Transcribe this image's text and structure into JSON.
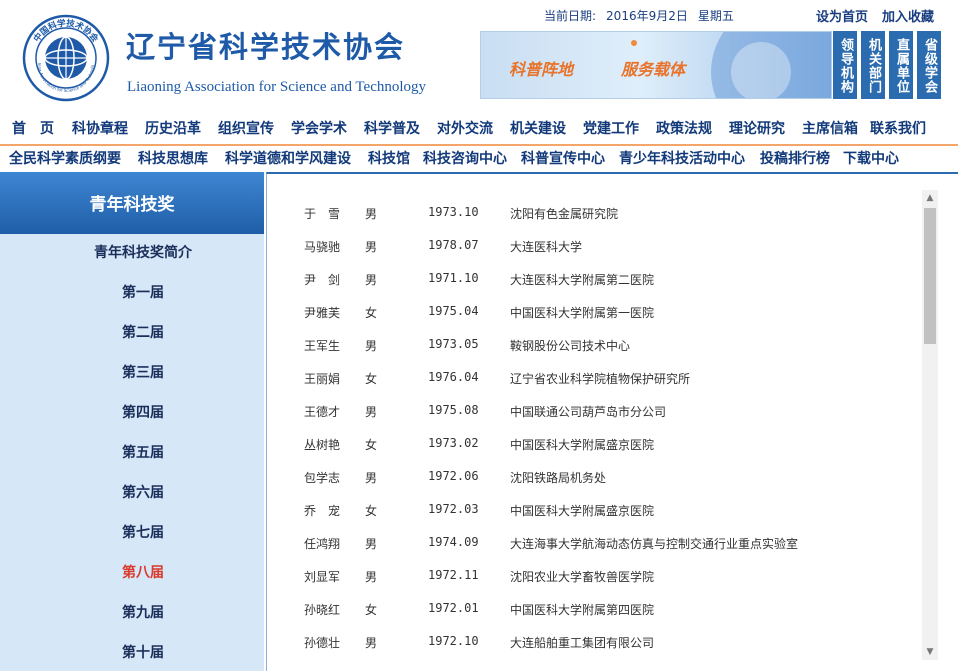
{
  "header": {
    "logo_text": "中国科学技术协会",
    "logo_subtext": "China Association for Science and Technology",
    "title_cn": "辽宁省科学技术协会",
    "title_en": "Liaoning Association for Science and Technology",
    "date_label": "当前日期:",
    "date_value": "2016年9月2日",
    "weekday": "星期五",
    "set_home": "设为首页",
    "add_fav": "加入收藏",
    "banner_slogan_1": "科普阵地",
    "banner_slogan_2": "服务载体",
    "tiles": [
      "领导机构",
      "机关部门",
      "直属单位",
      "省级学会"
    ]
  },
  "nav1": [
    "首　页",
    "科协章程",
    "历史沿革",
    "组织宣传",
    "学会学术",
    "科学普及",
    "对外交流",
    "机关建设",
    "党建工作",
    "政策法规",
    "理论研究",
    "主席信箱",
    "联系我们"
  ],
  "nav2": [
    "全民科学素质纲要",
    "科技思想库",
    "科学道德和学风建设",
    "科技馆",
    "科技咨询中心",
    "科普宣传中心",
    "青少年科技活动中心",
    "投稿排行榜",
    "下载中心"
  ],
  "sidebar": {
    "title": "青年科技奖",
    "links": [
      "青年科技奖简介",
      "第一届",
      "第二届",
      "第三届",
      "第四届",
      "第五届",
      "第六届",
      "第七届",
      "第八届",
      "第九届",
      "第十届"
    ],
    "active_index": 8,
    "active_color": "#d93a2b"
  },
  "winners": [
    {
      "name": "于　雪",
      "gender": "男",
      "birth": "1973.10",
      "unit": "沈阳有色金属研究院"
    },
    {
      "name": "马骁驰",
      "gender": "男",
      "birth": "1978.07",
      "unit": "大连医科大学"
    },
    {
      "name": "尹　剑",
      "gender": "男",
      "birth": "1971.10",
      "unit": "大连医科大学附属第二医院"
    },
    {
      "name": "尹雅芙",
      "gender": "女",
      "birth": "1975.04",
      "unit": "中国医科大学附属第一医院"
    },
    {
      "name": "王军生",
      "gender": "男",
      "birth": "1973.05",
      "unit": "鞍钢股份公司技术中心"
    },
    {
      "name": "王丽娟",
      "gender": "女",
      "birth": "1976.04",
      "unit": "辽宁省农业科学院植物保护研究所"
    },
    {
      "name": "王德才",
      "gender": "男",
      "birth": "1975.08",
      "unit": "中国联通公司葫芦岛市分公司"
    },
    {
      "name": "丛树艳",
      "gender": "女",
      "birth": "1973.02",
      "unit": "中国医科大学附属盛京医院"
    },
    {
      "name": "包学志",
      "gender": "男",
      "birth": "1972.06",
      "unit": "沈阳铁路局机务处"
    },
    {
      "name": "乔　宠",
      "gender": "女",
      "birth": "1972.03",
      "unit": "中国医科大学附属盛京医院"
    },
    {
      "name": "任鸿翔",
      "gender": "男",
      "birth": "1974.09",
      "unit": "大连海事大学航海动态仿真与控制交通行业重点实验室"
    },
    {
      "name": "刘显军",
      "gender": "男",
      "birth": "1972.11",
      "unit": "沈阳农业大学畜牧兽医学院"
    },
    {
      "name": "孙晓红",
      "gender": "女",
      "birth": "1972.01",
      "unit": "中国医科大学附属第四医院"
    },
    {
      "name": "孙德壮",
      "gender": "男",
      "birth": "1972.10",
      "unit": "大连船舶重工集团有限公司"
    }
  ],
  "colors": {
    "brand_blue": "#1e5aa8",
    "nav_text": "#123a7a",
    "sidebar_bg": "#d6e7f8",
    "separator": "#f3a56a"
  }
}
